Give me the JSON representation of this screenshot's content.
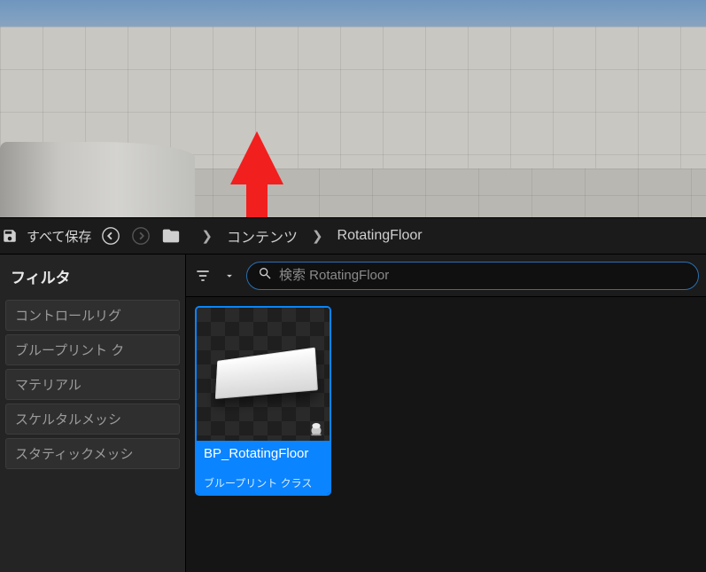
{
  "toolbar": {
    "save_all_label": "すべて保存"
  },
  "breadcrumb": {
    "items": [
      "コンテンツ",
      "RotatingFloor"
    ]
  },
  "sidebar": {
    "header": "フィルタ",
    "filters": [
      "コントロールリグ",
      "ブループリント ク",
      "マテリアル",
      "スケルタルメッシ",
      "スタティックメッシ"
    ]
  },
  "search": {
    "placeholder": "検索 RotatingFloor"
  },
  "assets": [
    {
      "name": "BP_RotatingFloor",
      "type": "ブループリント クラス"
    }
  ]
}
